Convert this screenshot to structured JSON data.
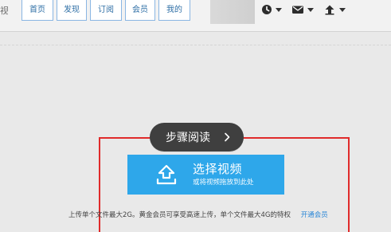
{
  "nav": {
    "brand_cut": "视",
    "items": [
      "首页",
      "发现",
      "订阅",
      "会员",
      "我的"
    ]
  },
  "tooltip": {
    "label": "步骤阅读"
  },
  "upload": {
    "title": "选择视频",
    "subtitle": "或将视频拖放到此处"
  },
  "info": {
    "text": "上传单个文件最大2G。黄金会员可享受高速上传，单个文件最大4G的特权",
    "link": "开通会员"
  },
  "colors": {
    "accent_blue": "#2ea7ea",
    "frame_red": "#e02b2b",
    "nav_border": "#8ab6e3"
  }
}
